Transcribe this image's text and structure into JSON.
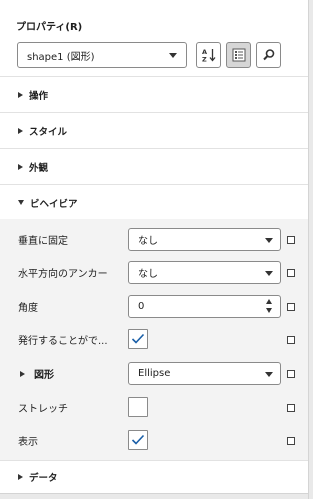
{
  "panel": {
    "title": "プロパティ(R)",
    "shape_select": {
      "value": "shape1 (図形)"
    },
    "toolbar": {
      "sort_icon": "sort-az-icon",
      "categorized_icon": "categorized-view-icon",
      "search_icon": "search-icon",
      "categorized_active": true
    }
  },
  "sections": {
    "operation": "操作",
    "style": "スタイル",
    "appearance": "外観",
    "behavior": "ビヘイビア",
    "data": "データ"
  },
  "behavior": {
    "rows": {
      "pin_vertical": {
        "label": "垂直に固定",
        "value": "なし"
      },
      "horizontal_anchor": {
        "label": "水平方向のアンカー",
        "value": "なし"
      },
      "angle": {
        "label": "角度",
        "value": "0"
      },
      "can_fire": {
        "label": "発行することがで...",
        "checked": true
      },
      "shape": {
        "label": "図形",
        "value": "Ellipse"
      },
      "stretch": {
        "label": "ストレッチ",
        "checked": false
      },
      "visible": {
        "label": "表示",
        "checked": true
      }
    }
  },
  "colors": {
    "expanded_bg": "#f3f3f3",
    "border": "#8a8a8a",
    "text": "#1f1f1f"
  }
}
